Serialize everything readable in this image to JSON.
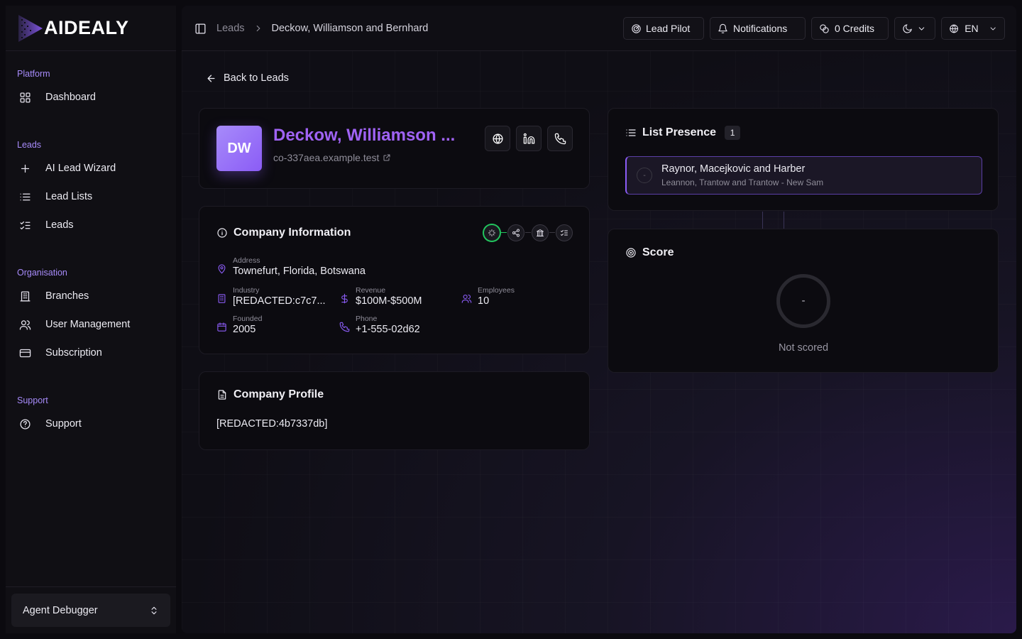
{
  "brand": {
    "name": "AIDEALY"
  },
  "sidebar": {
    "sections": [
      {
        "label": "Platform"
      },
      {
        "label": "Leads"
      },
      {
        "label": "Organisation"
      },
      {
        "label": "Support"
      }
    ],
    "items": [
      {
        "label": "Dashboard",
        "icon": "grid-icon"
      },
      {
        "label": "AI Lead Wizard",
        "icon": "plus-icon"
      },
      {
        "label": "Lead Lists",
        "icon": "list-icon"
      },
      {
        "label": "Leads",
        "icon": "list-checks-icon"
      },
      {
        "label": "Branches",
        "icon": "building-icon"
      },
      {
        "label": "User Management",
        "icon": "users-icon"
      },
      {
        "label": "Subscription",
        "icon": "credit-card-icon"
      },
      {
        "label": "Support",
        "icon": "help-circle-icon"
      }
    ],
    "footer": {
      "agent_label": "Agent Debugger"
    }
  },
  "header": {
    "breadcrumb": {
      "parent": "Leads",
      "current": "Deckow, Williamson and Bernhard"
    },
    "lead_pilot": "Lead Pilot",
    "notifications": "Notifications",
    "credits": "0 Credits",
    "language": "EN"
  },
  "main": {
    "back_label": "Back to Leads",
    "lead": {
      "initials": "DW",
      "name": "Deckow, Williamson ...",
      "domain": "co-337aea.example.test"
    },
    "company_info": {
      "title": "Company Information",
      "address_label": "Address",
      "address": "Townefurt, Florida, Botswana",
      "industry_label": "Industry",
      "industry": "[REDACTED:c7c7...",
      "revenue_label": "Revenue",
      "revenue": "$100M-$500M",
      "employees_label": "Employees",
      "employees": "10",
      "founded_label": "Founded",
      "founded": "2005",
      "phone_label": "Phone",
      "phone": "+1-555-02d62"
    },
    "company_profile": {
      "title": "Company Profile",
      "text": "[REDACTED:4b7337db]"
    },
    "list_presence": {
      "title": "List Presence",
      "count": "1",
      "items": [
        {
          "marker": "-",
          "title": "Raynor, Macejkovic and Harber",
          "subtitle": "Leannon, Trantow and Trantow - New Sam"
        }
      ]
    },
    "score": {
      "title": "Score",
      "value": "-",
      "status": "Not scored"
    }
  },
  "colors": {
    "accent": "#8b5cf6",
    "accent_text": "#a063f5",
    "active_step": "#22c55e"
  }
}
